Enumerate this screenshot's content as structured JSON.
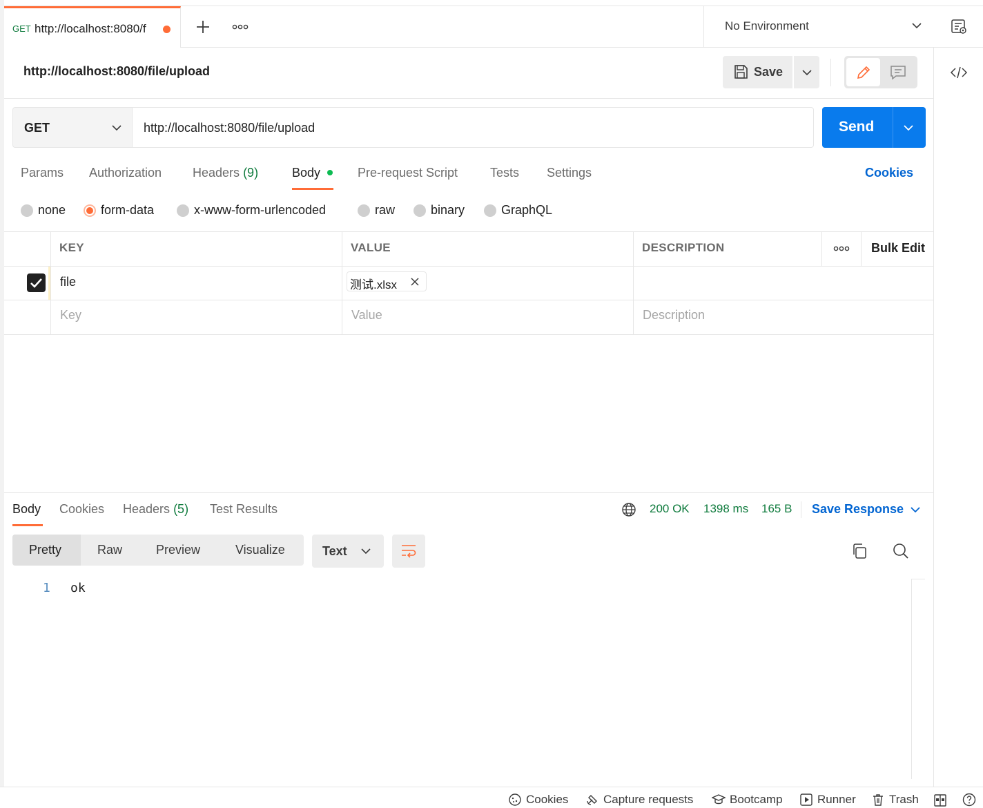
{
  "tab": {
    "method": "GET",
    "url": "http://localhost:8080/f"
  },
  "environment": {
    "selected": "No Environment"
  },
  "request": {
    "title": "http://localhost:8080/file/upload",
    "save_label": "Save",
    "method": "GET",
    "url": "http://localhost:8080/file/upload",
    "send_label": "Send"
  },
  "request_tabs": {
    "params": "Params",
    "authorization": "Authorization",
    "headers": "Headers",
    "headers_count": "(9)",
    "body": "Body",
    "prerequest": "Pre-request Script",
    "tests": "Tests",
    "settings": "Settings",
    "cookies": "Cookies"
  },
  "body_types": {
    "none": "none",
    "form_data": "form-data",
    "urlencoded": "x-www-form-urlencoded",
    "raw": "raw",
    "binary": "binary",
    "graphql": "GraphQL",
    "selected": "form-data"
  },
  "form_table": {
    "columns": {
      "key": "KEY",
      "value": "VALUE",
      "description": "DESCRIPTION",
      "bulk_edit": "Bulk Edit"
    },
    "rows": [
      {
        "checked": true,
        "key": "file",
        "value": "测试.xlsx",
        "description": ""
      }
    ],
    "placeholders": {
      "key": "Key",
      "value": "Value",
      "description": "Description"
    }
  },
  "response": {
    "tabs": {
      "body": "Body",
      "cookies": "Cookies",
      "headers": "Headers",
      "headers_count": "(5)",
      "test_results": "Test Results"
    },
    "status": "200 OK",
    "time": "1398 ms",
    "size": "165 B",
    "save_response": "Save Response",
    "views": {
      "pretty": "Pretty",
      "raw": "Raw",
      "preview": "Preview",
      "visualize": "Visualize"
    },
    "format": "Text",
    "lines": [
      {
        "number": "1",
        "text": "ok"
      }
    ]
  },
  "statusbar": {
    "cookies": "Cookies",
    "capture": "Capture requests",
    "bootcamp": "Bootcamp",
    "runner": "Runner",
    "trash": "Trash"
  },
  "colors": {
    "accent_orange": "#ff6c37",
    "send_blue": "#097bed",
    "link_blue": "#0265d2",
    "status_green": "#0f7b3d"
  }
}
